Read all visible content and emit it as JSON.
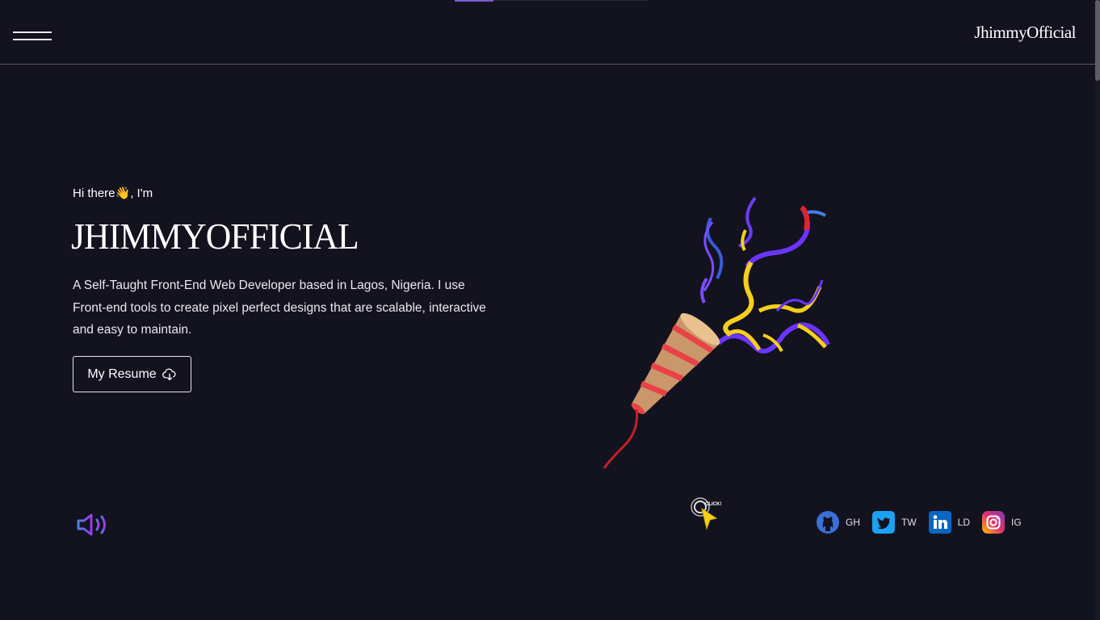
{
  "header": {
    "logo": "JhimmyOfficial",
    "menu_icon": "hamburger-menu-icon"
  },
  "hero": {
    "greeting": "Hi there👋, I'm",
    "name": "JHIMMYOFFICIAL",
    "bio": "A Self-Taught Front-End Web Developer based in Lagos, Nigeria. I use Front-end tools to create pixel perfect designs that are scalable, interactive and easy to maintain.",
    "resume_label": "My Resume",
    "resume_icon": "cloud-download-icon"
  },
  "sound": {
    "icon": "speaker-icon"
  },
  "click_hint": {
    "label": "CLICK!",
    "icon": "click-cursor-icon"
  },
  "socials": [
    {
      "label": "GH",
      "icon": "github-icon",
      "color": "#3b6fd8"
    },
    {
      "label": "TW",
      "icon": "twitter-icon",
      "color": "#1da1f2"
    },
    {
      "label": "LD",
      "icon": "linkedin-icon",
      "color": "#0a66c2"
    },
    {
      "label": "IG",
      "icon": "instagram-icon",
      "color": "#e1306c"
    }
  ],
  "colors": {
    "background": "#13121f",
    "accent": "#7c5cd6",
    "text": "#ffffff"
  }
}
